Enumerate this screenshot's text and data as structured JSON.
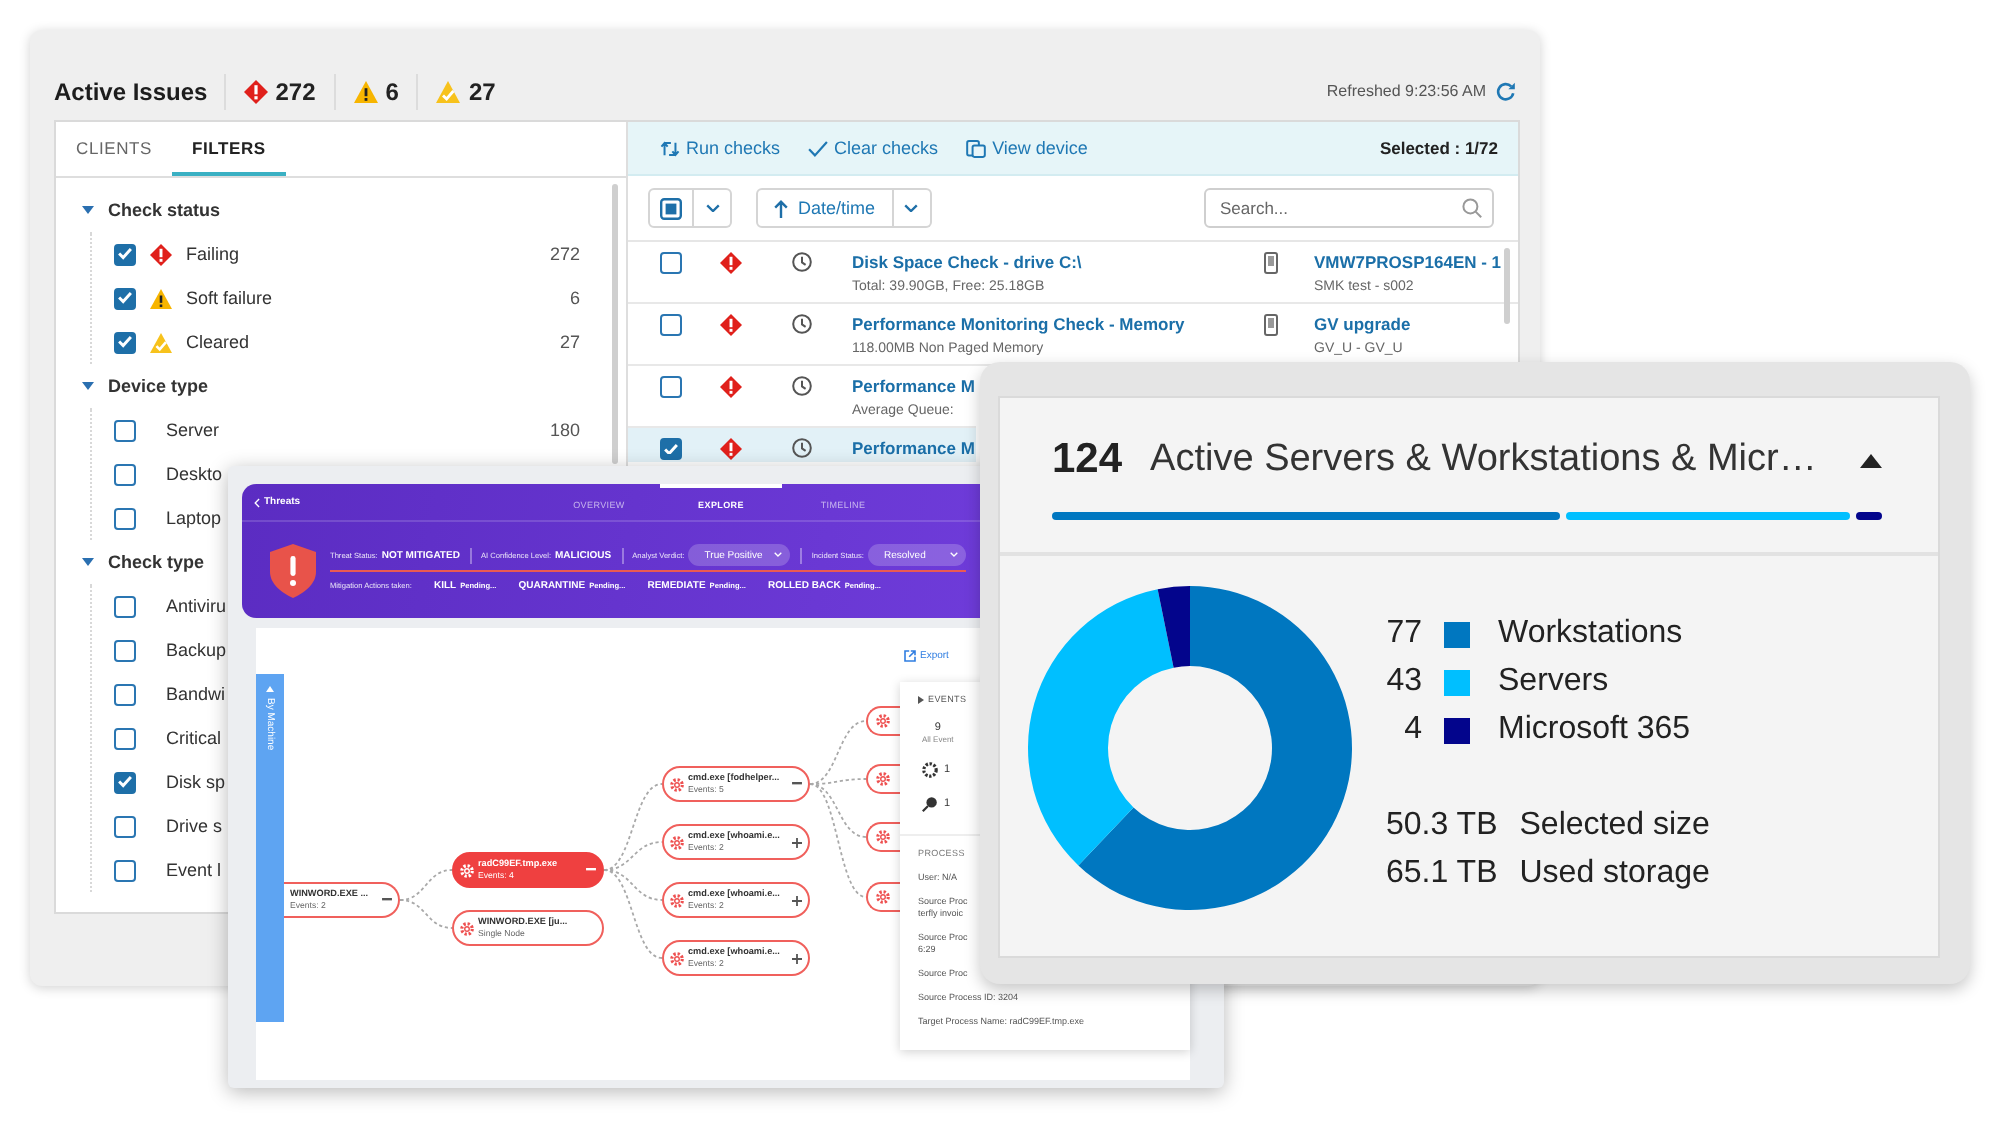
{
  "issues_window": {
    "title": "Active Issues",
    "counts": [
      {
        "kind": "failing",
        "value": "272"
      },
      {
        "kind": "soft_failure",
        "value": "6"
      },
      {
        "kind": "cleared",
        "value": "27"
      }
    ],
    "refreshed": "Refreshed 9:23:56 AM",
    "tabs": [
      {
        "label": "CLIENTS",
        "selected": false
      },
      {
        "label": "FILTERS",
        "selected": true
      }
    ],
    "filter_groups": [
      {
        "title": "Check status",
        "expanded": true,
        "items": [
          {
            "label": "Failing",
            "kind": "failing",
            "checked": true,
            "count": "272"
          },
          {
            "label": "Soft failure",
            "kind": "soft_failure",
            "checked": true,
            "count": "6"
          },
          {
            "label": "Cleared",
            "kind": "cleared",
            "checked": true,
            "count": "27"
          }
        ]
      },
      {
        "title": "Device type",
        "expanded": true,
        "items": [
          {
            "label": "Server",
            "kind": "plain",
            "checked": false,
            "count": "180"
          },
          {
            "label": "Deskto",
            "kind": "plain",
            "checked": false
          },
          {
            "label": "Laptop",
            "kind": "plain",
            "checked": false
          }
        ]
      },
      {
        "title": "Check type",
        "expanded": true,
        "items": [
          {
            "label": "Antiviru",
            "kind": "plain",
            "checked": false
          },
          {
            "label": "Backup",
            "kind": "plain",
            "checked": false
          },
          {
            "label": "Bandwi",
            "kind": "plain",
            "checked": false
          },
          {
            "label": "Critical",
            "kind": "plain",
            "checked": false
          },
          {
            "label": "Disk sp",
            "kind": "plain",
            "checked": true
          },
          {
            "label": "Drive s",
            "kind": "plain",
            "checked": false
          },
          {
            "label": "Event l",
            "kind": "plain",
            "checked": false
          }
        ]
      }
    ],
    "actions": [
      {
        "label": "Run checks",
        "kind": "run"
      },
      {
        "label": "Clear checks",
        "kind": "clear"
      },
      {
        "label": "View device",
        "kind": "view"
      }
    ],
    "selection": "Selected : 1/72",
    "select_all": {
      "indeterminate": true
    },
    "sort": {
      "label": "Date/time",
      "ascending": true
    },
    "search": {
      "placeholder": "Search..."
    },
    "rows": [
      {
        "title": "Disk Space Check - drive C:\\",
        "detail": "Total: 39.90GB, Free: 25.18GB",
        "kind": "failing",
        "device": "VMW7PROSP164EN - 1",
        "device_detail": "SMK test - s002",
        "checked": false,
        "selected": false
      },
      {
        "title": "Performance Monitoring Check - Memory",
        "detail": "118.00MB Non Paged Memory",
        "kind": "failing",
        "device": "GV upgrade",
        "device_detail": "GV_U - GV_U",
        "checked": false,
        "selected": false
      },
      {
        "title": "Performance M",
        "detail": "Average Queue:",
        "kind": "failing",
        "checked": false,
        "selected": false
      },
      {
        "title": "Performance M",
        "kind": "failing",
        "checked": true,
        "selected": true
      }
    ]
  },
  "threat_window": {
    "back_label": "Threats",
    "tabs": [
      {
        "label": "OVERVIEW",
        "selected": false
      },
      {
        "label": "EXPLORE",
        "selected": true
      },
      {
        "label": "TIMELINE",
        "selected": false
      }
    ],
    "fields": [
      {
        "label": "Threat Status:",
        "value": "NOT MITIGATED",
        "kind": "text"
      },
      {
        "label": "AI Confidence Level:",
        "value": "MALICIOUS",
        "kind": "text"
      },
      {
        "label": "Analyst Verdict:",
        "value": "True Positive",
        "kind": "dropdown"
      },
      {
        "label": "Incident Status:",
        "value": "Resolved",
        "kind": "dropdown"
      }
    ],
    "mitigation_label": "Mitigation Actions taken:",
    "mitigation_actions": [
      {
        "name": "KILL",
        "status": "Pending..."
      },
      {
        "name": "QUARANTINE",
        "status": "Pending..."
      },
      {
        "name": "REMEDIATE",
        "status": "Pending..."
      },
      {
        "name": "ROLLED BACK",
        "status": "Pending..."
      }
    ],
    "side_tab": "By Machine",
    "export": "Export",
    "graph": [
      {
        "kind": "root",
        "name": "WINWORD.EXE ...",
        "detail": "Events: 2",
        "highlighted": false,
        "expanded": true,
        "children": [
          {
            "kind": "process",
            "name": "radC99EF.tmp.exe",
            "detail": "Events: 4",
            "highlighted": true,
            "expanded": true,
            "children": [
              {
                "kind": "process",
                "name": "cmd.exe [fodhelper...",
                "detail": "Events: 5",
                "highlighted": false,
                "expanded": true,
                "children": [
                  {
                    "kind": "clipped",
                    "highlighted": false
                  },
                  {
                    "kind": "clipped",
                    "highlighted": false
                  },
                  {
                    "kind": "clipped",
                    "highlighted": false
                  },
                  {
                    "kind": "clipped",
                    "highlighted": false
                  }
                ]
              },
              {
                "kind": "process",
                "name": "cmd.exe [whoami.e...",
                "detail": "Events: 2",
                "highlighted": false,
                "expanded": false
              },
              {
                "kind": "process",
                "name": "cmd.exe [whoami.e...",
                "detail": "Events: 2",
                "highlighted": false,
                "expanded": false
              },
              {
                "kind": "process",
                "name": "cmd.exe [whoami.e...",
                "detail": "Events: 2",
                "highlighted": false,
                "expanded": false
              }
            ]
          },
          {
            "kind": "process",
            "name": "WINWORD.EXE [ju...",
            "detail": "Single Node",
            "highlighted": false
          }
        ]
      }
    ],
    "events": {
      "title": "EVENTS",
      "counters": [
        {
          "kind": "total",
          "count": "9",
          "label": "All Event"
        },
        {
          "kind": "network",
          "count": "1"
        },
        {
          "kind": "indicator",
          "count": "1"
        }
      ],
      "section": "PROCESS",
      "details": [
        [
          "User: N/A"
        ],
        [
          "Source Proc",
          "terfly invoic"
        ],
        [
          "Source Proc",
          "6:29"
        ],
        [
          "Source Proc"
        ],
        [
          "Source Process ID: 3204"
        ],
        [
          "Target Process Name: radC99EF.tmp.exe"
        ]
      ]
    }
  },
  "device_card": {
    "total": "124",
    "title": "Active Servers & Workstations & Micr…",
    "expanded": true,
    "legend": [
      {
        "count": "77",
        "color": "#0077c0"
      },
      {
        "count": "43",
        "color": "#00bfff"
      },
      {
        "count": "4",
        "color": "#03058c"
      }
    ],
    "chart_data": {
      "type": "donut",
      "categories": [
        "Workstations",
        "Servers",
        "Microsoft 365"
      ],
      "values": [
        62.1,
        34.7,
        3.2
      ]
    },
    "storage": [
      {
        "amount": "50.3 TB",
        "text": "Selected size"
      },
      {
        "amount": "65.1 TB",
        "text": "Used storage"
      }
    ]
  }
}
